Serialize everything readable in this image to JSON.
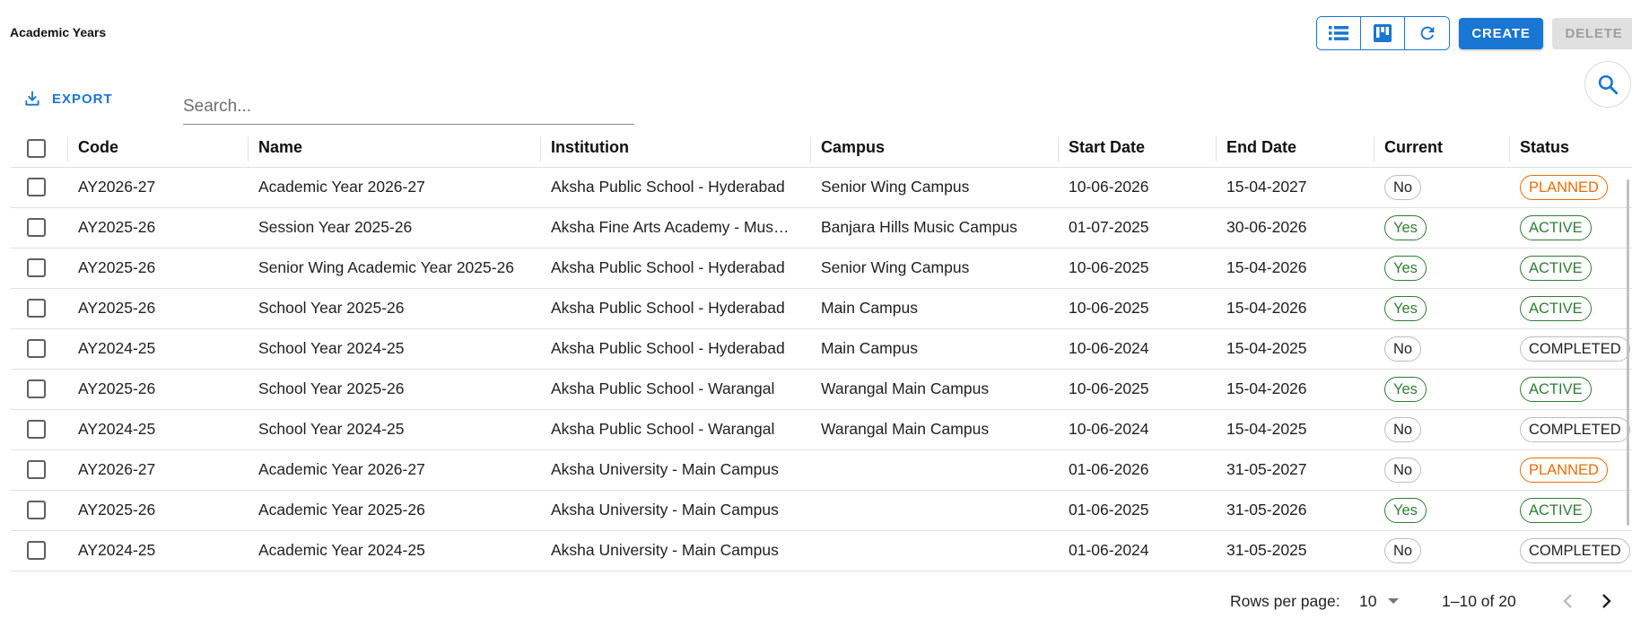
{
  "page": {
    "title": "Academic Years"
  },
  "toolbar": {
    "views": [
      {
        "icon": "list-view-icon"
      },
      {
        "icon": "kanban-view-icon"
      },
      {
        "icon": "refresh-icon"
      }
    ],
    "create_label": "CREATE",
    "delete_label": "DELETE"
  },
  "export": {
    "label": "EXPORT",
    "icon": "download-icon"
  },
  "search": {
    "placeholder": "Search...",
    "value": ""
  },
  "table": {
    "columns": [
      "Code",
      "Name",
      "Institution",
      "Campus",
      "Start Date",
      "End Date",
      "Current",
      "Status"
    ],
    "rows": [
      {
        "code": "AY2026-27",
        "name": "Academic Year 2026-27",
        "institution": "Aksha Public School - Hyderabad",
        "campus": "Senior Wing Campus",
        "start": "10-06-2026",
        "end": "15-04-2027",
        "current": "No",
        "status": "PLANNED"
      },
      {
        "code": "AY2025-26",
        "name": "Session Year 2025-26",
        "institution": "Aksha Fine Arts Academy - Mus…",
        "campus": "Banjara Hills Music Campus",
        "start": "01-07-2025",
        "end": "30-06-2026",
        "current": "Yes",
        "status": "ACTIVE"
      },
      {
        "code": "AY2025-26",
        "name": "Senior Wing Academic Year 2025-26",
        "institution": "Aksha Public School - Hyderabad",
        "campus": "Senior Wing Campus",
        "start": "10-06-2025",
        "end": "15-04-2026",
        "current": "Yes",
        "status": "ACTIVE"
      },
      {
        "code": "AY2025-26",
        "name": "School Year 2025-26",
        "institution": "Aksha Public School - Hyderabad",
        "campus": "Main Campus",
        "start": "10-06-2025",
        "end": "15-04-2026",
        "current": "Yes",
        "status": "ACTIVE"
      },
      {
        "code": "AY2024-25",
        "name": "School Year 2024-25",
        "institution": "Aksha Public School - Hyderabad",
        "campus": "Main Campus",
        "start": "10-06-2024",
        "end": "15-04-2025",
        "current": "No",
        "status": "COMPLETED"
      },
      {
        "code": "AY2025-26",
        "name": "School Year 2025-26",
        "institution": "Aksha Public School - Warangal",
        "campus": "Warangal Main Campus",
        "start": "10-06-2025",
        "end": "15-04-2026",
        "current": "Yes",
        "status": "ACTIVE"
      },
      {
        "code": "AY2024-25",
        "name": "School Year 2024-25",
        "institution": "Aksha Public School - Warangal",
        "campus": "Warangal Main Campus",
        "start": "10-06-2024",
        "end": "15-04-2025",
        "current": "No",
        "status": "COMPLETED"
      },
      {
        "code": "AY2026-27",
        "name": "Academic Year 2026-27",
        "institution": "Aksha University - Main Campus",
        "campus": "",
        "start": "01-06-2026",
        "end": "31-05-2027",
        "current": "No",
        "status": "PLANNED"
      },
      {
        "code": "AY2025-26",
        "name": "Academic Year 2025-26",
        "institution": "Aksha University - Main Campus",
        "campus": "",
        "start": "01-06-2025",
        "end": "31-05-2026",
        "current": "Yes",
        "status": "ACTIVE"
      },
      {
        "code": "AY2024-25",
        "name": "Academic Year 2024-25",
        "institution": "Aksha University - Main Campus",
        "campus": "",
        "start": "01-06-2024",
        "end": "31-05-2025",
        "current": "No",
        "status": "COMPLETED"
      }
    ]
  },
  "pagination": {
    "rows_per_page_label": "Rows per page:",
    "rows_per_page": "10",
    "range": "1–10 of 20"
  },
  "colors": {
    "primary": "#1976d2",
    "success": "#2e7d32",
    "warning": "#ed6c02",
    "disabled_bg": "#e0e0e0"
  }
}
